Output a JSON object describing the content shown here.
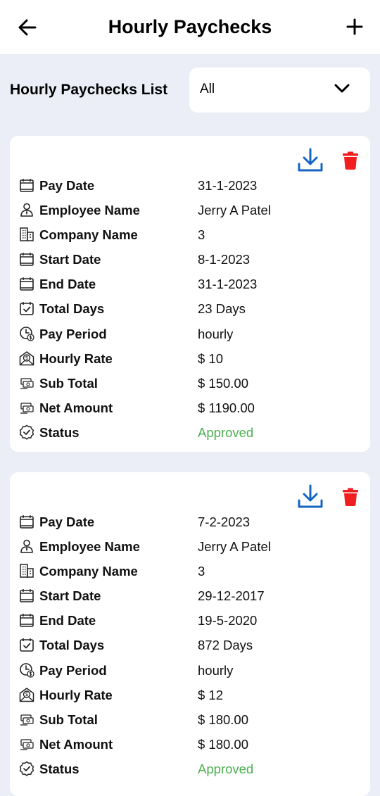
{
  "appbar": {
    "title": "Hourly Paychecks"
  },
  "filter": {
    "list_title": "Hourly Paychecks List",
    "selected": "All"
  },
  "labels": {
    "pay_date": "Pay Date",
    "employee_name": "Employee Name",
    "company_name": "Company Name",
    "start_date": "Start Date",
    "end_date": "End Date",
    "total_days": "Total Days",
    "pay_period": "Pay Period",
    "hourly_rate": "Hourly Rate",
    "sub_total": "Sub Total",
    "net_amount": "Net Amount",
    "status": "Status"
  },
  "paychecks": [
    {
      "pay_date": "31-1-2023",
      "employee_name": "Jerry A Patel",
      "company_name": "3",
      "start_date": "8-1-2023",
      "end_date": "31-1-2023",
      "total_days": "23 Days",
      "pay_period": "hourly",
      "hourly_rate": "$ 10",
      "sub_total": "$ 150.00",
      "net_amount": "$ 1190.00",
      "status": "Approved"
    },
    {
      "pay_date": "7-2-2023",
      "employee_name": "Jerry A Patel",
      "company_name": "3",
      "start_date": "29-12-2017",
      "end_date": "19-5-2020",
      "total_days": "872 Days",
      "pay_period": "hourly",
      "hourly_rate": "$ 12",
      "sub_total": "$ 180.00",
      "net_amount": "$ 180.00",
      "status": "Approved"
    }
  ],
  "colors": {
    "accent": "#1565c0",
    "delete": "#f01e1e",
    "approved": "#4caf50",
    "background": "#ebeef6"
  },
  "icons": {
    "back": "arrow-left-icon",
    "add": "plus-icon",
    "dropdown": "chevron-down-icon",
    "download": "download-icon",
    "delete": "trash-icon",
    "pay_date": "calendar-icon",
    "employee_name": "person-icon",
    "company_name": "building-icon",
    "start_date": "calendar-icon",
    "end_date": "calendar-icon",
    "total_days": "calendar-check-icon",
    "pay_period": "clock-dollar-icon",
    "hourly_rate": "money-badge-icon",
    "sub_total": "cash-icon",
    "net_amount": "cash-icon",
    "status": "verified-badge-icon"
  }
}
